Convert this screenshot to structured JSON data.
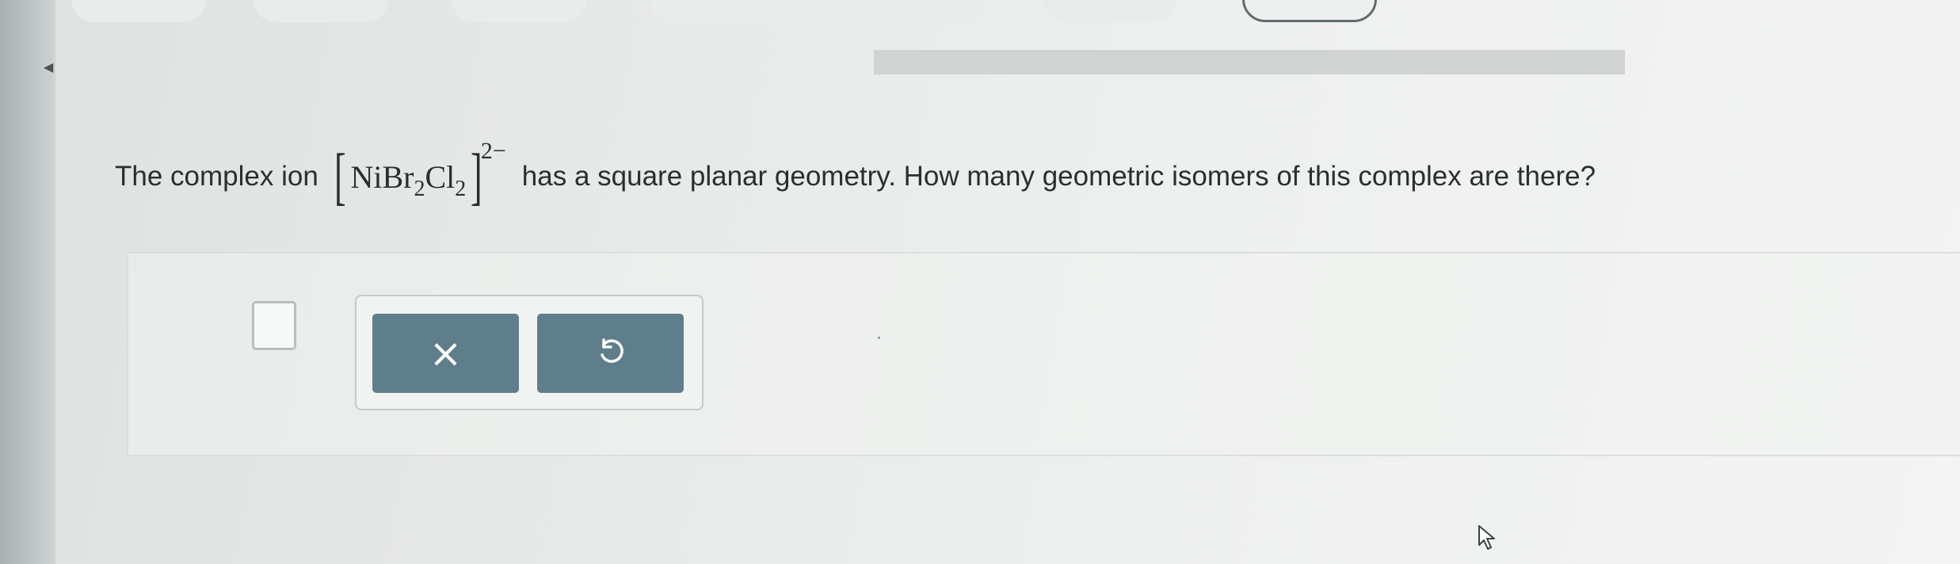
{
  "question": {
    "before": "The complex ion",
    "formula": {
      "base": "NiBr",
      "sub1": "2",
      "mid": "Cl",
      "sub2": "2",
      "charge": "2−"
    },
    "after": "has a square planar geometry. How many geometric isomers of this complex are there?"
  },
  "answer": {
    "value": ""
  },
  "buttons": {
    "clear_icon": "close-icon",
    "undo_icon": "undo-icon"
  },
  "colors": {
    "button": "#5f7e8c",
    "progress": "#d1d3d3",
    "text": "#2b2e30"
  }
}
